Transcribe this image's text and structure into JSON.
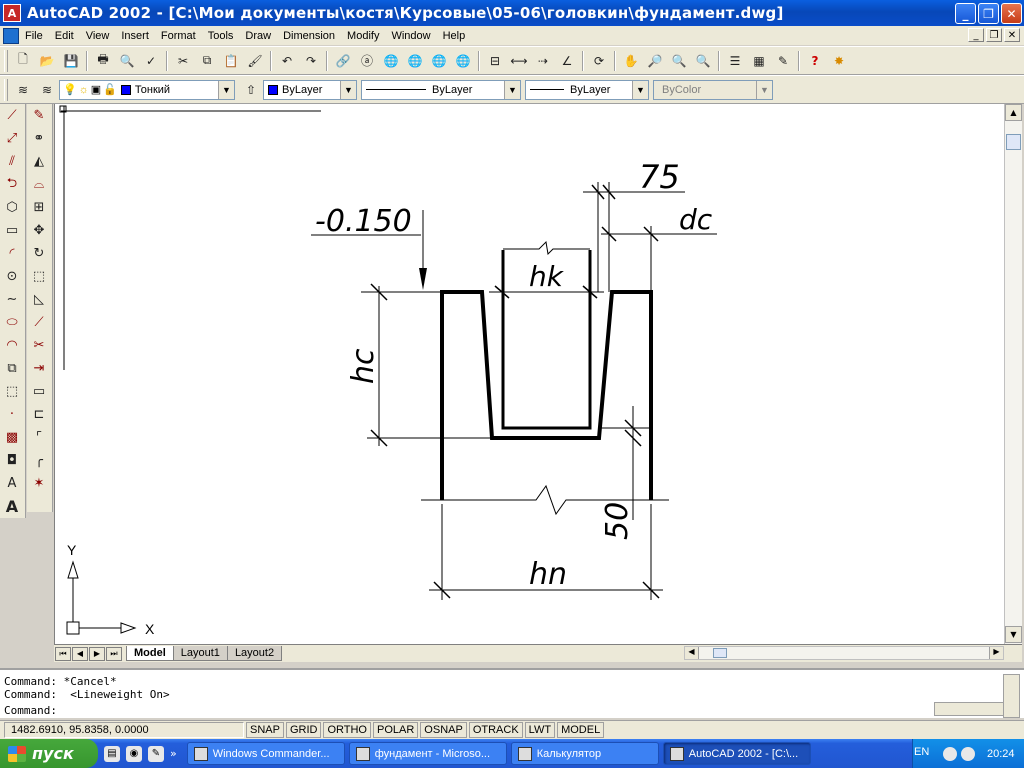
{
  "window": {
    "title": "AutoCAD 2002 - [C:\\Мои документы\\костя\\Курсовые\\05-06\\головкин\\фундамент.dwg]",
    "min_label": "_",
    "max_label": "❐",
    "close_label": "✕"
  },
  "menu": [
    "File",
    "Edit",
    "View",
    "Insert",
    "Format",
    "Tools",
    "Draw",
    "Dimension",
    "Modify",
    "Window",
    "Help"
  ],
  "layers_toolbar": {
    "layer_name": "Тонкий",
    "color_value": "ByLayer",
    "linetype_value": "ByLayer",
    "lineweight_value": "ByLayer",
    "plotstyle_value": "ByColor"
  },
  "drawing": {
    "elevation": "-0.150",
    "dim_75": "75",
    "dim_dc": "dc",
    "dim_hk": "hk",
    "dim_hc": "hc",
    "dim_50": "50",
    "dim_hn": "hn",
    "ucs_x": "X",
    "ucs_y": "Y"
  },
  "tabs": [
    "Model",
    "Layout1",
    "Layout2"
  ],
  "command": {
    "line1": "Command: *Cancel*",
    "line2": "Command:  <Lineweight On>",
    "line3": "Command:"
  },
  "status": {
    "coords": "1482.6910, 95.8358, 0.0000",
    "buttons": [
      "SNAP",
      "GRID",
      "ORTHO",
      "POLAR",
      "OSNAP",
      "OTRACK",
      "LWT",
      "MODEL"
    ]
  },
  "taskbar": {
    "start_label": "пуск",
    "tasks": [
      "Windows Commander...",
      "фундамент - Microso...",
      "Калькулятор",
      "AutoCAD 2002 - [C:\\..."
    ],
    "lang": "EN",
    "clock": "20:24"
  },
  "colors": {
    "titlebar": "#0747b8",
    "taskbar": "#245edb",
    "start": "#37962e",
    "layer_color": "#0000ff"
  }
}
